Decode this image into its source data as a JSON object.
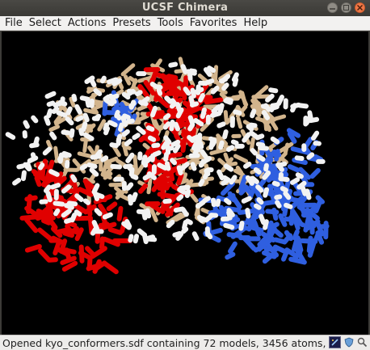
{
  "window": {
    "title": "UCSF Chimera"
  },
  "menu": [
    "File",
    "Select",
    "Actions",
    "Presets",
    "Tools",
    "Favorites",
    "Help"
  ],
  "status": {
    "message": "Opened kyo_conformers.sdf containing 72 models, 3456 atoms,"
  },
  "icons": [
    "minimize-icon",
    "maximize-icon",
    "close-icon",
    "command-line-icon",
    "shield-icon",
    "magnifier-icon"
  ],
  "colors": {
    "oxygen": "#e00000",
    "nitrogen": "#2f5fe0",
    "carbon": "#d2b48c",
    "hydrogen": "#f2f2f2",
    "background": "#000000"
  }
}
